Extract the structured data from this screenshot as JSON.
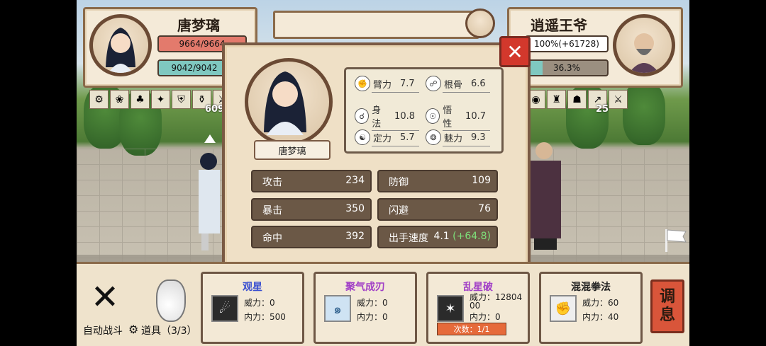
{
  "player": {
    "name": "唐梦璃",
    "hp": "9664/9664",
    "mp": "9042/9042",
    "icons": [
      "gear-buff-icon",
      "lotus-icon",
      "sprout-icon",
      "kick-icon",
      "shield-icon",
      "vase-icon",
      "sword-icon"
    ],
    "icon_count": "609"
  },
  "enemy": {
    "name": "逍遥王爷",
    "hp": "100%(+61728)",
    "mp": "36.3%",
    "icons": [
      "eye-icon",
      "helmet-icon",
      "beast-icon",
      "spear-icon",
      "sword-icon"
    ],
    "icon_count": "25"
  },
  "modal": {
    "name": "唐梦璃",
    "close": "✕",
    "attrs": [
      {
        "label": "臂力",
        "value": "7.7",
        "icon": "fist-icon"
      },
      {
        "label": "根骨",
        "value": "6.6",
        "icon": "bone-icon"
      },
      {
        "label": "身法",
        "value": "10.8",
        "icon": "run-icon"
      },
      {
        "label": "悟性",
        "value": "10.7",
        "icon": "mind-icon"
      },
      {
        "label": "定力",
        "value": "5.7",
        "icon": "calm-icon"
      },
      {
        "label": "魅力",
        "value": "9.3",
        "icon": "charm-icon"
      }
    ],
    "stats": [
      {
        "label": "攻击",
        "value": "234"
      },
      {
        "label": "防御",
        "value": "109"
      },
      {
        "label": "暴击",
        "value": "350"
      },
      {
        "label": "闪避",
        "value": "76"
      },
      {
        "label": "命中",
        "value": "392"
      },
      {
        "label": "出手速度",
        "value": "4.1",
        "bonus": "(+64.8)"
      }
    ]
  },
  "bottom": {
    "auto_battle": "自动战斗",
    "items": "道具（3/3）",
    "rest": [
      "调",
      "息"
    ],
    "skills": [
      {
        "title": "观星",
        "title_color": "#3a4fd0",
        "l1": "威力：0",
        "l2": "内力：500"
      },
      {
        "title": "聚气成刃",
        "title_color": "#a13fc7",
        "l1": "威力：0",
        "l2": "内力：0"
      },
      {
        "title": "乱星破",
        "title_color": "#a13fc7",
        "l1": "威力：12804",
        "l1b": "00",
        "l2": "内力：0",
        "count": "次数：1/1"
      },
      {
        "title": "混混拳法",
        "title_color": "#222222",
        "l1": "威力：60",
        "l2": "内力：40"
      }
    ]
  }
}
